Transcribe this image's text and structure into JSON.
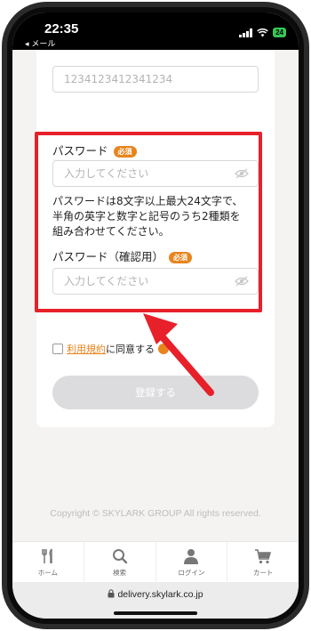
{
  "status_bar": {
    "time": "22:35",
    "back_label": "◂ メール",
    "battery": "24",
    "accent": "#35c759"
  },
  "form": {
    "card_number_value": "1234123412341234",
    "password_label": "パスワード",
    "required_badge": "必須",
    "password_placeholder": "入力してください",
    "password_note_lines": [
      "パスワードは8文字以上最大24文字で、",
      "半角の英字と数字と記号のうち2種類を",
      "組み合わせてください。"
    ],
    "confirm_label": "パスワード（確認用）",
    "confirm_placeholder": "入力してください",
    "terms_link": "利用規約",
    "terms_text": "に同意する",
    "register_button": "登録する"
  },
  "footer": {
    "copyright": "Copyright © SKYLARK GROUP All rights reserved."
  },
  "tabbar": {
    "items": [
      {
        "label": "ホーム",
        "icon": "fork-knife-icon"
      },
      {
        "label": "検索",
        "icon": "search-icon"
      },
      {
        "label": "ログイン",
        "icon": "person-icon"
      },
      {
        "label": "カート",
        "icon": "cart-icon"
      }
    ]
  },
  "browser": {
    "url": "delivery.skylark.co.jp",
    "icon": "lock-icon"
  },
  "colors": {
    "accent": "#e8841d",
    "highlight": "#e7202a",
    "button_disabled": "#dcdcdf"
  }
}
